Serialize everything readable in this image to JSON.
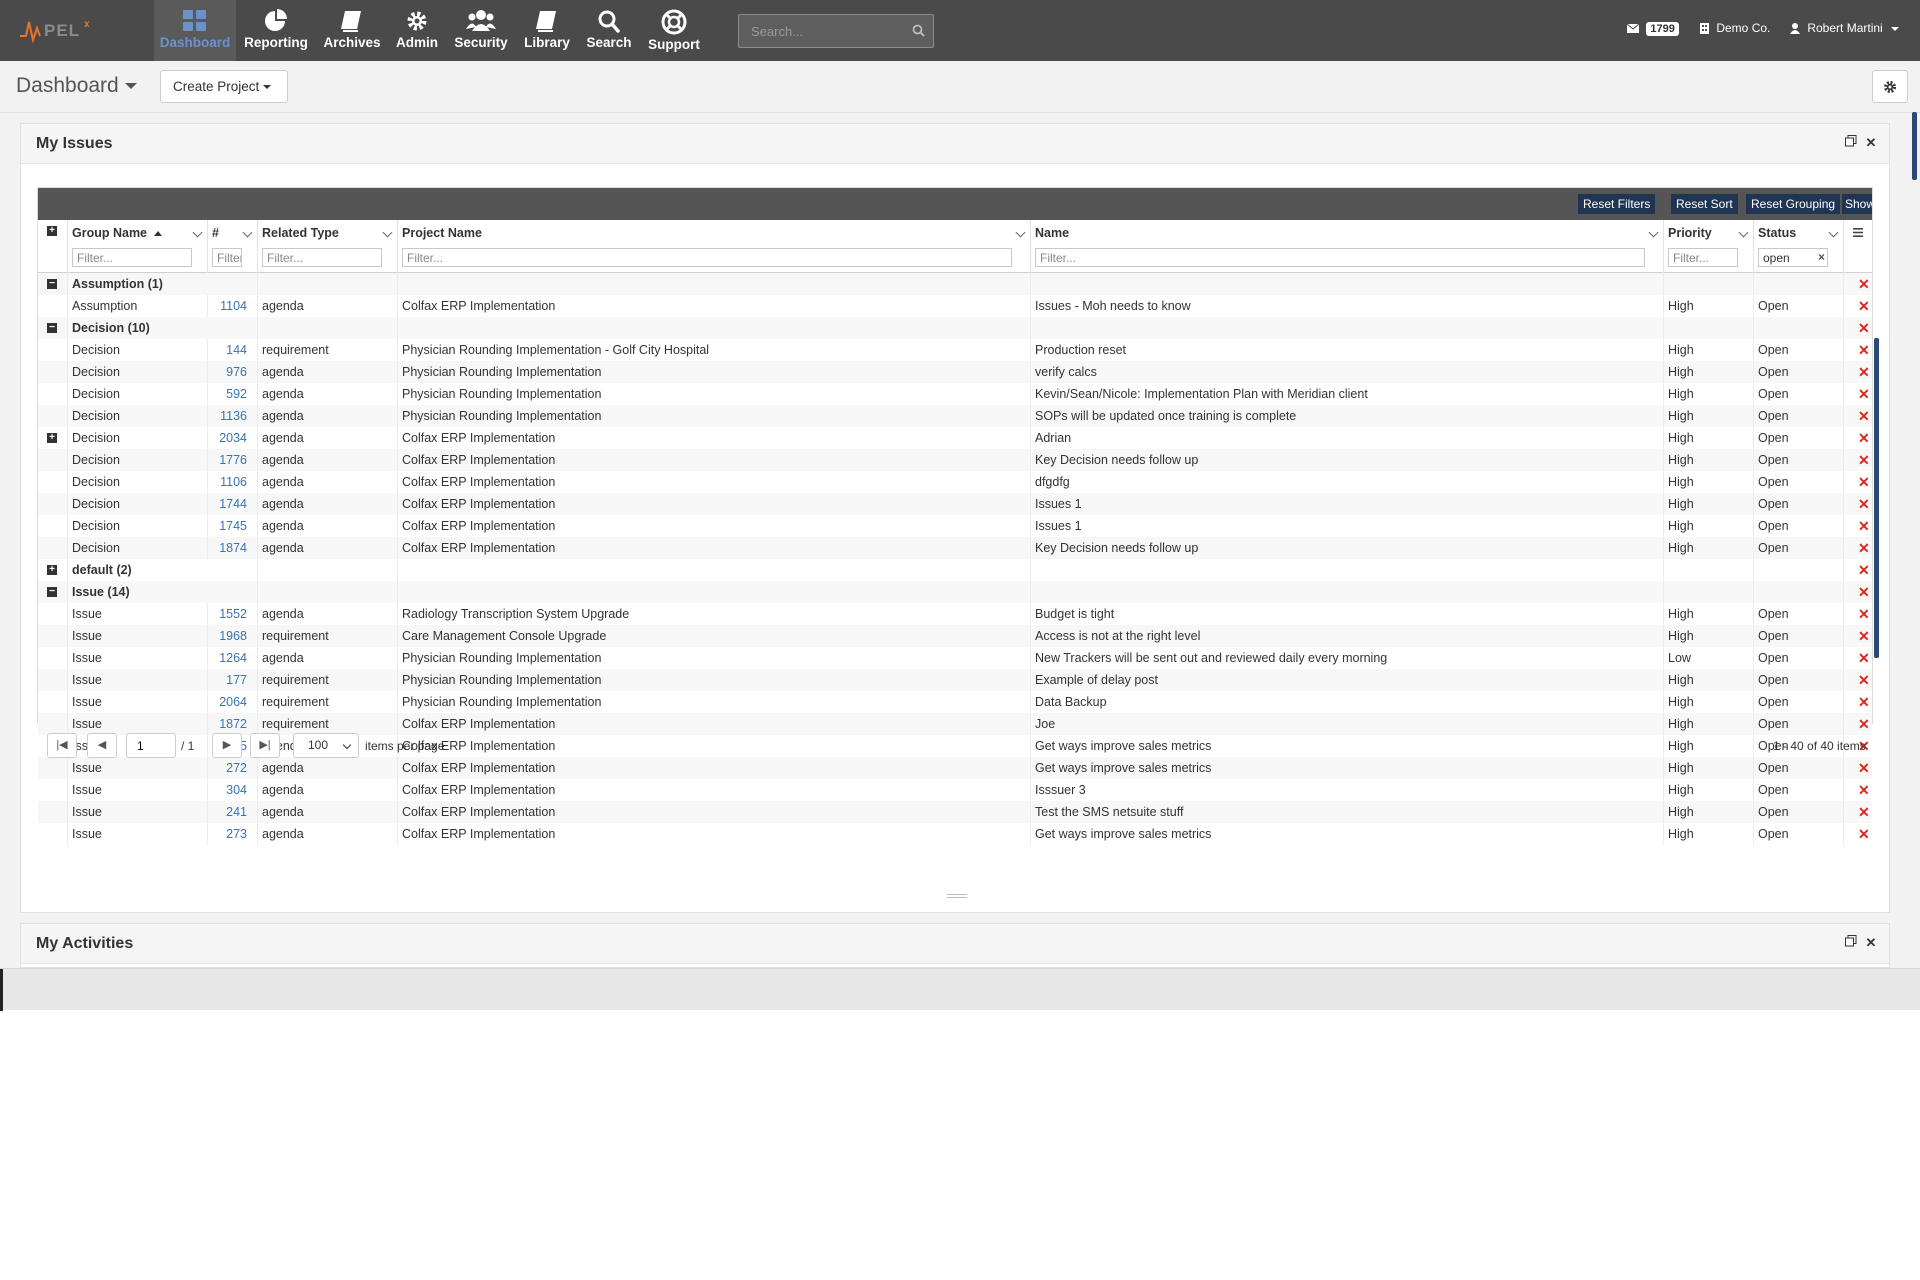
{
  "nav": {
    "logo_text": "INPELX",
    "items": [
      {
        "label": "Dashboard",
        "icon": "dashboard-icon"
      },
      {
        "label": "Reporting",
        "icon": "pie-chart-icon"
      },
      {
        "label": "Archives",
        "icon": "book-icon"
      },
      {
        "label": "Admin",
        "icon": "gear-icon"
      },
      {
        "label": "Security",
        "icon": "users-icon"
      },
      {
        "label": "Library",
        "icon": "book-icon"
      },
      {
        "label": "Search",
        "icon": "search-icon"
      },
      {
        "label": "Support",
        "icon": "life-ring-icon"
      }
    ],
    "search_placeholder": "Search...",
    "mail_count": "1799",
    "company": "Demo Co.",
    "user": "Robert Martini"
  },
  "subheader": {
    "title": "Dashboard",
    "create_label": "Create Project"
  },
  "issues_panel": {
    "title": "My Issues",
    "toolbar": [
      "Reset Filters",
      "Reset Sort",
      "Reset Grouping",
      "Show All Columns"
    ],
    "columns": [
      {
        "label": "Group Name",
        "filter_placeholder": "Filter..."
      },
      {
        "label": "#",
        "filter_placeholder": "Filter..."
      },
      {
        "label": "Related Type",
        "filter_placeholder": "Filter..."
      },
      {
        "label": "Project Name",
        "filter_placeholder": "Filter..."
      },
      {
        "label": "Name",
        "filter_placeholder": "Filter..."
      },
      {
        "label": "Priority",
        "filter_placeholder": "Filter..."
      },
      {
        "label": "Status",
        "filter_value": "open"
      }
    ],
    "rows": [
      {
        "kind": "group",
        "label": "Assumption (1)",
        "expanded": true
      },
      {
        "kind": "data",
        "group": "Assumption",
        "num": "1104",
        "type": "agenda",
        "project": "Colfax ERP Implementation",
        "name": "Issues - Moh needs to know",
        "priority": "High",
        "status": "Open"
      },
      {
        "kind": "group",
        "label": "Decision (10)",
        "expanded": true
      },
      {
        "kind": "data",
        "group": "Decision",
        "num": "144",
        "type": "requirement",
        "project": "Physician Rounding Implementation - Golf City Hospital",
        "name": "Production reset",
        "priority": "High",
        "status": "Open"
      },
      {
        "kind": "data",
        "group": "Decision",
        "num": "976",
        "type": "agenda",
        "project": "Physician Rounding Implementation",
        "name": "verify calcs",
        "priority": "High",
        "status": "Open"
      },
      {
        "kind": "data",
        "group": "Decision",
        "num": "592",
        "type": "agenda",
        "project": "Physician Rounding Implementation",
        "name": "Kevin/Sean/Nicole: Implementation Plan with Meridian client",
        "priority": "High",
        "status": "Open"
      },
      {
        "kind": "data",
        "group": "Decision",
        "num": "1136",
        "type": "agenda",
        "project": "Physician Rounding Implementation",
        "name": "SOPs will be updated once training is complete",
        "priority": "High",
        "status": "Open"
      },
      {
        "kind": "data",
        "group": "Decision",
        "num": "2034",
        "type": "agenda",
        "project": "Colfax ERP Implementation",
        "name": "Adrian",
        "priority": "High",
        "status": "Open",
        "expander": true
      },
      {
        "kind": "data",
        "group": "Decision",
        "num": "1776",
        "type": "agenda",
        "project": "Colfax ERP Implementation",
        "name": "Key Decision needs follow up",
        "priority": "High",
        "status": "Open"
      },
      {
        "kind": "data",
        "group": "Decision",
        "num": "1106",
        "type": "agenda",
        "project": "Colfax ERP Implementation",
        "name": "dfgdfg",
        "priority": "High",
        "status": "Open"
      },
      {
        "kind": "data",
        "group": "Decision",
        "num": "1744",
        "type": "agenda",
        "project": "Colfax ERP Implementation",
        "name": "Issues 1",
        "priority": "High",
        "status": "Open"
      },
      {
        "kind": "data",
        "group": "Decision",
        "num": "1745",
        "type": "agenda",
        "project": "Colfax ERP Implementation",
        "name": "Issues 1",
        "priority": "High",
        "status": "Open"
      },
      {
        "kind": "data",
        "group": "Decision",
        "num": "1874",
        "type": "agenda",
        "project": "Colfax ERP Implementation",
        "name": "Key Decision needs follow up",
        "priority": "High",
        "status": "Open"
      },
      {
        "kind": "group",
        "label": "default (2)",
        "expanded": false
      },
      {
        "kind": "group",
        "label": "Issue (14)",
        "expanded": true
      },
      {
        "kind": "data",
        "group": "Issue",
        "num": "1552",
        "type": "agenda",
        "project": "Radiology Transcription System Upgrade",
        "name": "Budget is tight",
        "priority": "High",
        "status": "Open"
      },
      {
        "kind": "data",
        "group": "Issue",
        "num": "1968",
        "type": "requirement",
        "project": "Care Management Console Upgrade",
        "name": "Access is not at the right level",
        "priority": "High",
        "status": "Open"
      },
      {
        "kind": "data",
        "group": "Issue",
        "num": "1264",
        "type": "agenda",
        "project": "Physician Rounding Implementation",
        "name": "New Trackers will be sent out and reviewed daily every morning",
        "priority": "Low",
        "status": "Open"
      },
      {
        "kind": "data",
        "group": "Issue",
        "num": "177",
        "type": "requirement",
        "project": "Physician Rounding Implementation",
        "name": "Example of delay post",
        "priority": "High",
        "status": "Open"
      },
      {
        "kind": "data",
        "group": "Issue",
        "num": "2064",
        "type": "requirement",
        "project": "Physician Rounding Implementation",
        "name": "Data Backup",
        "priority": "High",
        "status": "Open"
      },
      {
        "kind": "data",
        "group": "Issue",
        "num": "1872",
        "type": "requirement",
        "project": "Colfax ERP Implementation",
        "name": "Joe",
        "priority": "High",
        "status": "Open"
      },
      {
        "kind": "data",
        "group": "Issue",
        "num": "305",
        "type": "agenda",
        "project": "Colfax ERP Implementation",
        "name": "Get ways improve sales metrics",
        "priority": "High",
        "status": "Open"
      },
      {
        "kind": "data",
        "group": "Issue",
        "num": "272",
        "type": "agenda",
        "project": "Colfax ERP Implementation",
        "name": "Get ways improve sales metrics",
        "priority": "High",
        "status": "Open"
      },
      {
        "kind": "data",
        "group": "Issue",
        "num": "304",
        "type": "agenda",
        "project": "Colfax ERP Implementation",
        "name": "Isssuer 3",
        "priority": "High",
        "status": "Open"
      },
      {
        "kind": "data",
        "group": "Issue",
        "num": "241",
        "type": "agenda",
        "project": "Colfax ERP Implementation",
        "name": "Test the SMS netsuite stuff",
        "priority": "High",
        "status": "Open"
      },
      {
        "kind": "data",
        "group": "Issue",
        "num": "273",
        "type": "agenda",
        "project": "Colfax ERP Implementation",
        "name": "Get ways improve sales metrics",
        "priority": "High",
        "status": "Open"
      }
    ],
    "pager": {
      "page": "1",
      "total_pages": "/ 1",
      "page_size": "100",
      "items_per_page_label": "items per page",
      "summary": "1 - 40 of 40 items"
    }
  },
  "activities_panel": {
    "title": "My Activities"
  }
}
